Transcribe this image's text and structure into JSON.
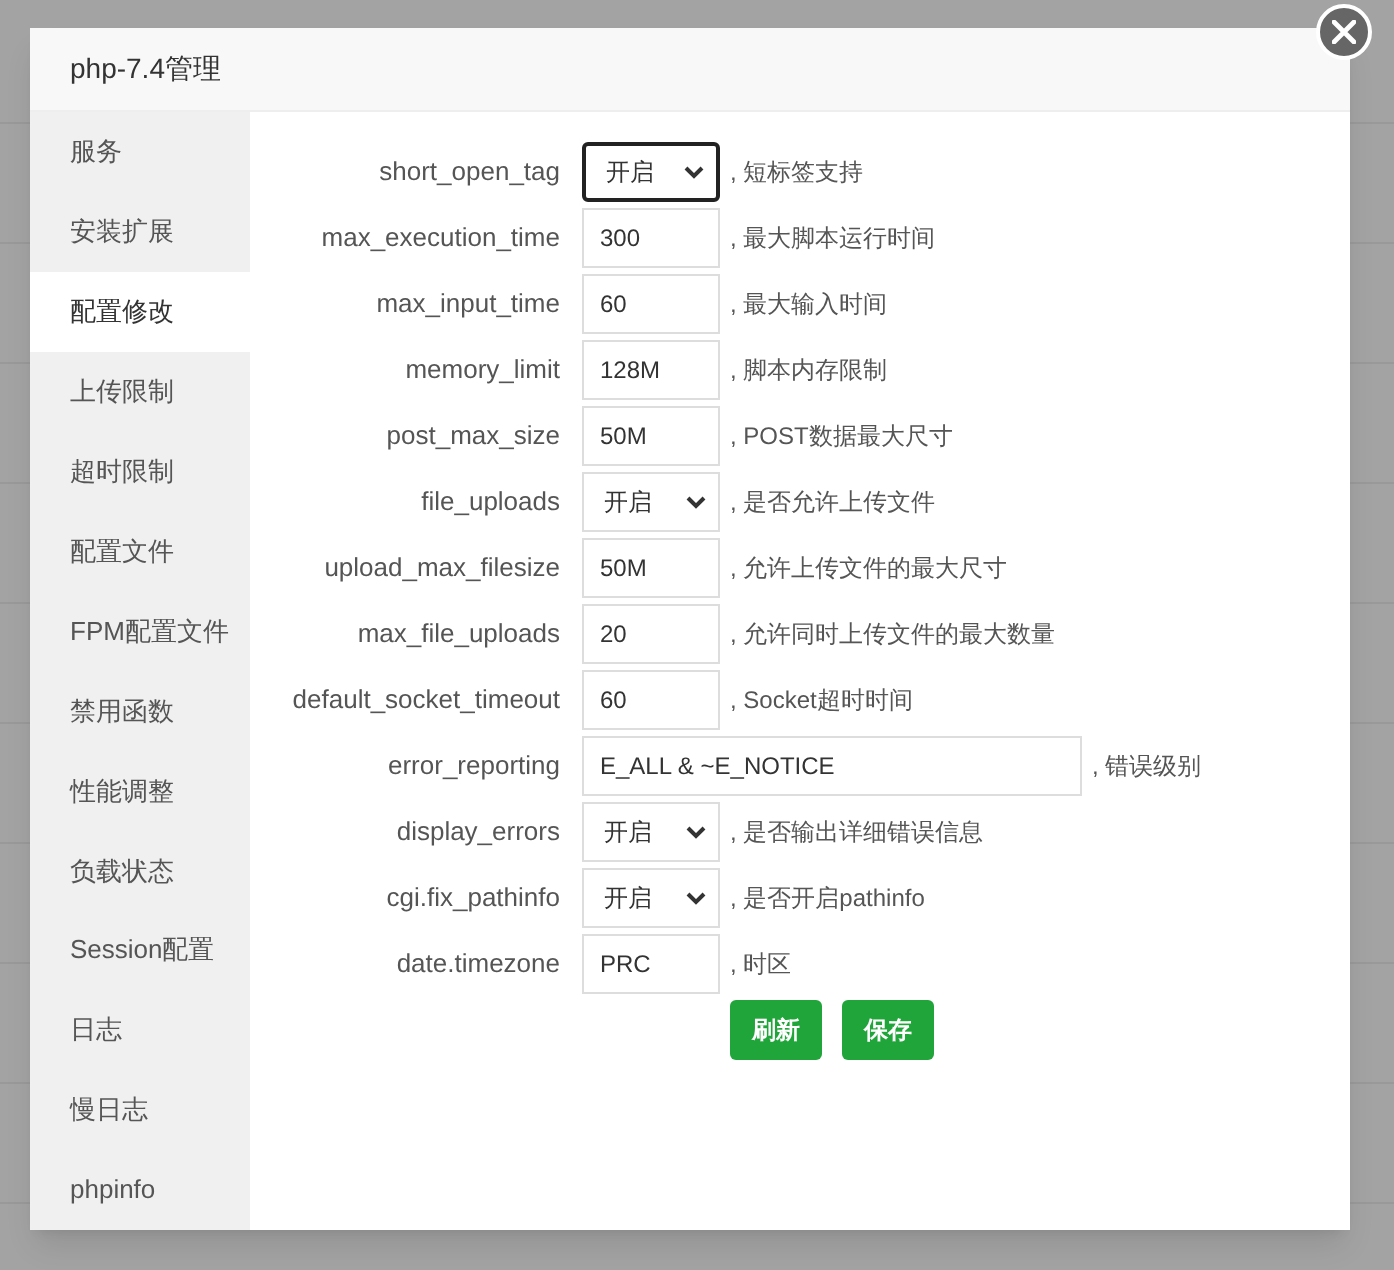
{
  "dialog": {
    "title": "php-7.4管理"
  },
  "sidebar": {
    "items": [
      {
        "label": "服务",
        "selected": false
      },
      {
        "label": "安装扩展",
        "selected": false
      },
      {
        "label": "配置修改",
        "selected": true
      },
      {
        "label": "上传限制",
        "selected": false
      },
      {
        "label": "超时限制",
        "selected": false
      },
      {
        "label": "配置文件",
        "selected": false
      },
      {
        "label": "FPM配置文件",
        "selected": false
      },
      {
        "label": "禁用函数",
        "selected": false
      },
      {
        "label": "性能调整",
        "selected": false
      },
      {
        "label": "负载状态",
        "selected": false
      },
      {
        "label": "Session配置",
        "selected": false
      },
      {
        "label": "日志",
        "selected": false
      },
      {
        "label": "慢日志",
        "selected": false
      },
      {
        "label": "phpinfo",
        "selected": false
      }
    ]
  },
  "settings": [
    {
      "label": "short_open_tag",
      "kind": "select",
      "value": "开启",
      "hint": ", 短标签支持",
      "focused": true
    },
    {
      "label": "max_execution_time",
      "kind": "input",
      "value": "300",
      "hint": ", 最大脚本运行时间",
      "focused": false
    },
    {
      "label": "max_input_time",
      "kind": "input",
      "value": "60",
      "hint": ", 最大输入时间",
      "focused": false
    },
    {
      "label": "memory_limit",
      "kind": "input",
      "value": "128M",
      "hint": ", 脚本内存限制",
      "focused": false
    },
    {
      "label": "post_max_size",
      "kind": "input",
      "value": "50M",
      "hint": ", POST数据最大尺寸",
      "focused": false
    },
    {
      "label": "file_uploads",
      "kind": "select",
      "value": "开启",
      "hint": ", 是否允许上传文件",
      "focused": false
    },
    {
      "label": "upload_max_filesize",
      "kind": "input",
      "value": "50M",
      "hint": ", 允许上传文件的最大尺寸",
      "focused": false
    },
    {
      "label": "max_file_uploads",
      "kind": "input",
      "value": "20",
      "hint": ", 允许同时上传文件的最大数量",
      "focused": false
    },
    {
      "label": "default_socket_timeout",
      "kind": "input",
      "value": "60",
      "hint": ", Socket超时时间",
      "focused": false
    },
    {
      "label": "error_reporting",
      "kind": "wide-input",
      "value": "E_ALL & ~E_NOTICE",
      "hint": ", 错误级别",
      "focused": false
    },
    {
      "label": "display_errors",
      "kind": "select",
      "value": "开启",
      "hint": ", 是否输出详细错误信息",
      "focused": false
    },
    {
      "label": "cgi.fix_pathinfo",
      "kind": "select",
      "value": "开启",
      "hint": ", 是否开启pathinfo",
      "focused": false
    },
    {
      "label": "date.timezone",
      "kind": "input",
      "value": "PRC",
      "hint": ", 时区",
      "focused": false
    }
  ],
  "buttons": [
    "刷新",
    "保存"
  ]
}
